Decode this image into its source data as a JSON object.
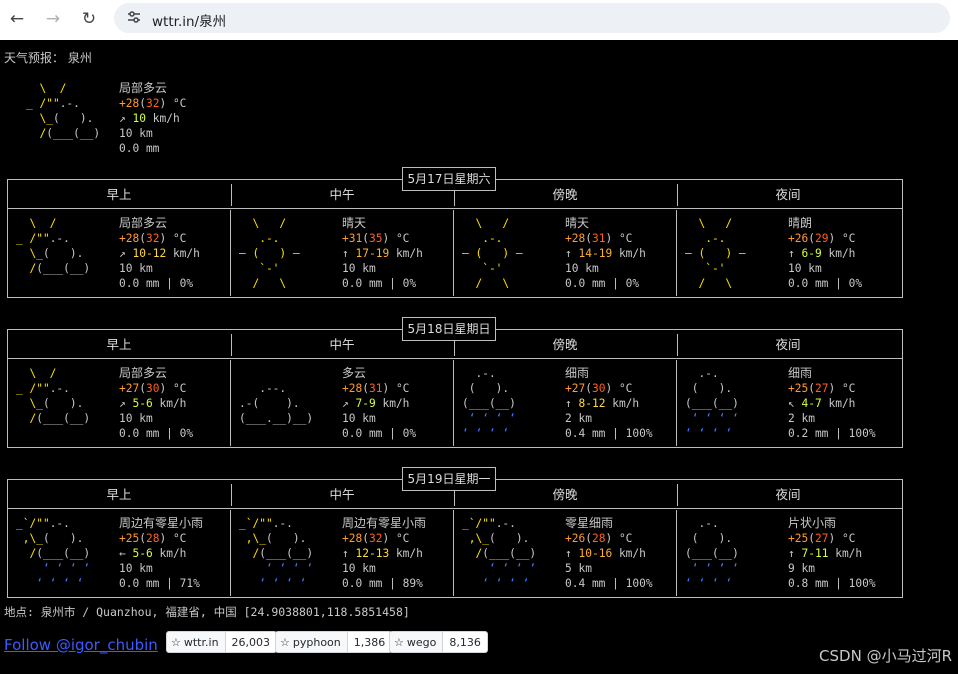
{
  "browser": {
    "url": "wttr.in/泉州",
    "back_icon": "arrow-left-icon",
    "forward_icon": "arrow-right-icon",
    "reload_icon": "reload-icon",
    "site_info_icon": "tune-icon"
  },
  "report_title": "天气预报： 泉州",
  "current": {
    "desc": "局部多云",
    "temp_a": "+28",
    "temp_b": "32",
    "temp_unit": "°C",
    "wind_arrow": "↗",
    "wind": "10",
    "wind_unit": "km/h",
    "visibility": "10 km",
    "precip": "0.0 mm"
  },
  "periods": [
    "早上",
    "中午",
    "傍晚",
    "夜间"
  ],
  "days": [
    {
      "date": "5月17日星期六",
      "cells": [
        {
          "icon": "partly-cloudy-icon",
          "desc": "局部多云",
          "t1": "+28",
          "t2": "32",
          "wind_arrow": "↗",
          "wind": "10-12",
          "vis": "10 km",
          "precip": "0.0 mm | 0%"
        },
        {
          "icon": "sunny-icon",
          "desc": "晴天",
          "t1": "+31",
          "t2": "35",
          "wind_arrow": "↑",
          "wind": "17-19",
          "vis": "10 km",
          "precip": "0.0 mm | 0%"
        },
        {
          "icon": "sunny-icon",
          "desc": "晴天",
          "t1": "+28",
          "t2": "31",
          "wind_arrow": "↑",
          "wind": "14-19",
          "vis": "10 km",
          "precip": "0.0 mm | 0%"
        },
        {
          "icon": "clear-night-icon",
          "desc": "晴朗",
          "t1": "+26",
          "t2": "29",
          "wind_arrow": "↑",
          "wind": "6-9",
          "vis": "10 km",
          "precip": "0.0 mm | 0%"
        }
      ]
    },
    {
      "date": "5月18日星期日",
      "cells": [
        {
          "icon": "partly-cloudy-icon",
          "desc": "局部多云",
          "t1": "+27",
          "t2": "30",
          "wind_arrow": "↗",
          "wind": "5-6",
          "vis": "10 km",
          "precip": "0.0 mm | 0%"
        },
        {
          "icon": "cloudy-icon",
          "desc": "多云",
          "t1": "+28",
          "t2": "31",
          "wind_arrow": "↗",
          "wind": "7-9",
          "vis": "10 km",
          "precip": "0.0 mm | 0%"
        },
        {
          "icon": "light-rain-icon",
          "desc": "细雨",
          "t1": "+27",
          "t2": "30",
          "wind_arrow": "↑",
          "wind": "8-12",
          "vis": "2 km",
          "precip": "0.4 mm | 100%"
        },
        {
          "icon": "light-rain-icon",
          "desc": "细雨",
          "t1": "+25",
          "t2": "27",
          "wind_arrow": "↖",
          "wind": "4-7",
          "vis": "2 km",
          "precip": "0.2 mm | 100%"
        }
      ]
    },
    {
      "date": "5月19日星期一",
      "cells": [
        {
          "icon": "patchy-rain-icon",
          "desc": "周边有零星小雨",
          "t1": "+25",
          "t2": "28",
          "wind_arrow": "←",
          "wind": "5-6",
          "vis": "10 km",
          "precip": "0.0 mm | 71%"
        },
        {
          "icon": "patchy-rain-icon",
          "desc": "周边有零星小雨",
          "t1": "+28",
          "t2": "32",
          "wind_arrow": "↑",
          "wind": "12-13",
          "vis": "10 km",
          "precip": "0.0 mm | 89%"
        },
        {
          "icon": "patchy-rain-icon",
          "desc": "零星细雨",
          "t1": "+26",
          "t2": "28",
          "wind_arrow": "↑",
          "wind": "10-16",
          "vis": "5 km",
          "precip": "0.4 mm | 100%"
        },
        {
          "icon": "light-rain-icon",
          "desc": "片状小雨",
          "t1": "+25",
          "t2": "27",
          "wind_arrow": "↑",
          "wind": "7-11",
          "vis": "9 km",
          "precip": "0.8 mm | 100%"
        }
      ]
    }
  ],
  "location": "地点: 泉州市 / Quanzhou, 福建省, 中国 [24.9038801,118.5851458]",
  "follow": "Follow @igor_chubin",
  "github_buttons": [
    {
      "label": "wttr.in",
      "count": "26,003"
    },
    {
      "label": "pyphoon",
      "count": "1,386"
    },
    {
      "label": "wego",
      "count": "8,136"
    }
  ],
  "watermark": "CSDN @小马过河R"
}
